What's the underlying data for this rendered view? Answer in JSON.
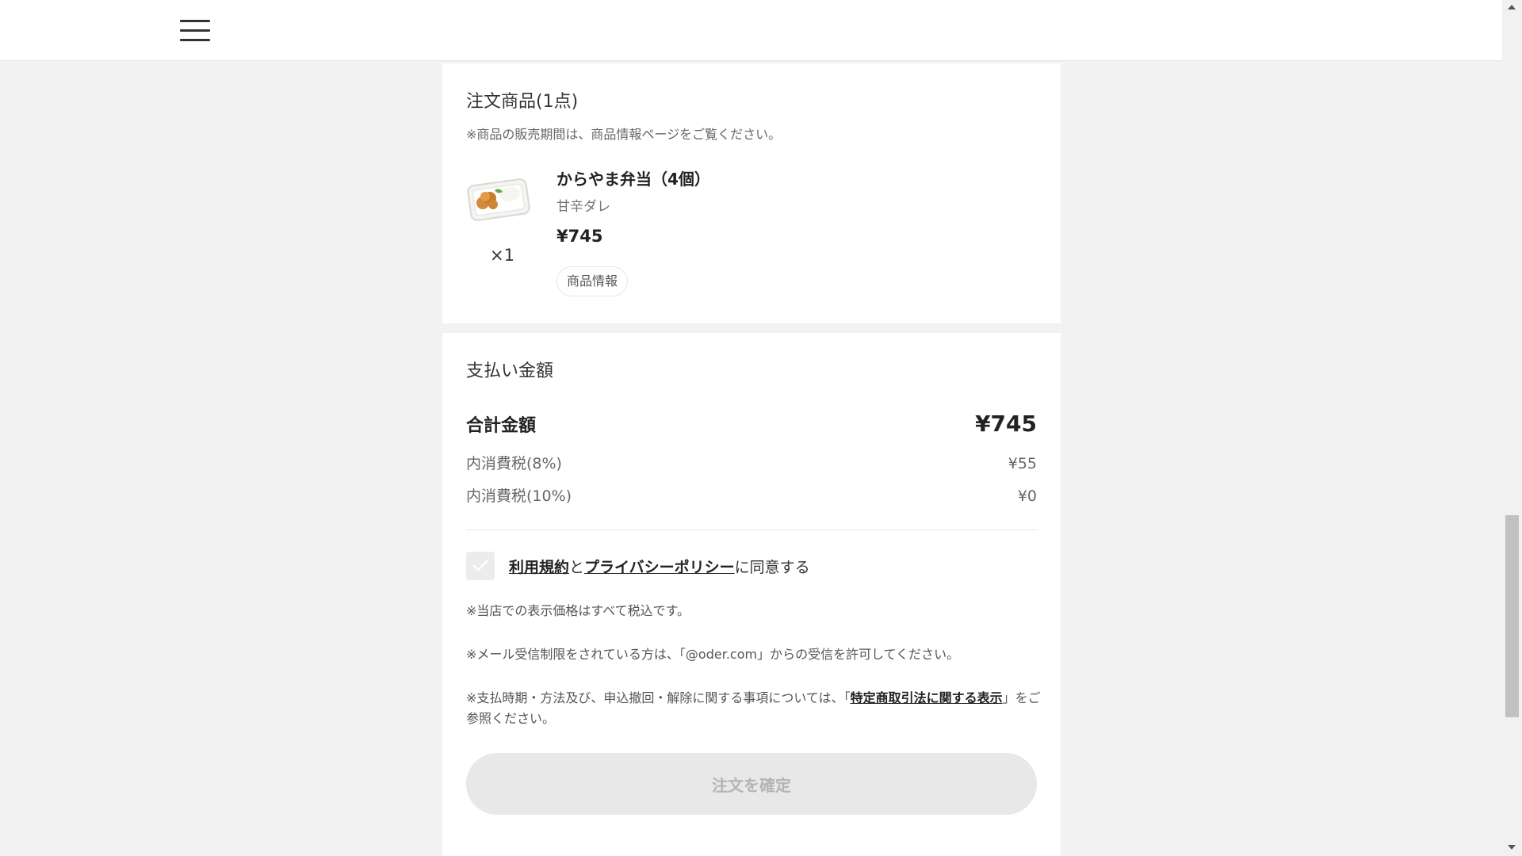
{
  "order_items": {
    "title": "注文商品(1点)",
    "note": "※商品の販売期間は、商品情報ページをご覧ください。",
    "items": [
      {
        "name": "からやま弁当（4個）",
        "option": "甘辛ダレ",
        "price": "¥745",
        "quantity": "×1",
        "info_button": "商品情報"
      }
    ]
  },
  "payment": {
    "title": "支払い金額",
    "total_label": "合計金額",
    "total_value": "¥745",
    "tax8_label": "内消費税(8%)",
    "tax8_value": "¥55",
    "tax10_label": "内消費税(10%)",
    "tax10_value": "¥0"
  },
  "agreement": {
    "terms_link": "利用規約",
    "connector": "と",
    "privacy_link": "プライバシーポリシー",
    "suffix": "に同意する"
  },
  "notes": {
    "tax_included": "※当店での表示価格はすべて税込です。",
    "email": "※メール受信制限をされている方は、「@oder.com」からの受信を許可してください。",
    "legal_prefix": "※支払時期・方法及び、申込撤回・解除に関する事項については、「",
    "legal_link": "特定商取引法に関する表示",
    "legal_suffix": "」をご参照ください。"
  },
  "confirm_button": "注文を確定",
  "colors": {
    "background": "#f2f2f2",
    "card": "#ffffff",
    "button_disabled_bg": "#e8e8e8",
    "button_disabled_text": "#b4b4b4"
  }
}
